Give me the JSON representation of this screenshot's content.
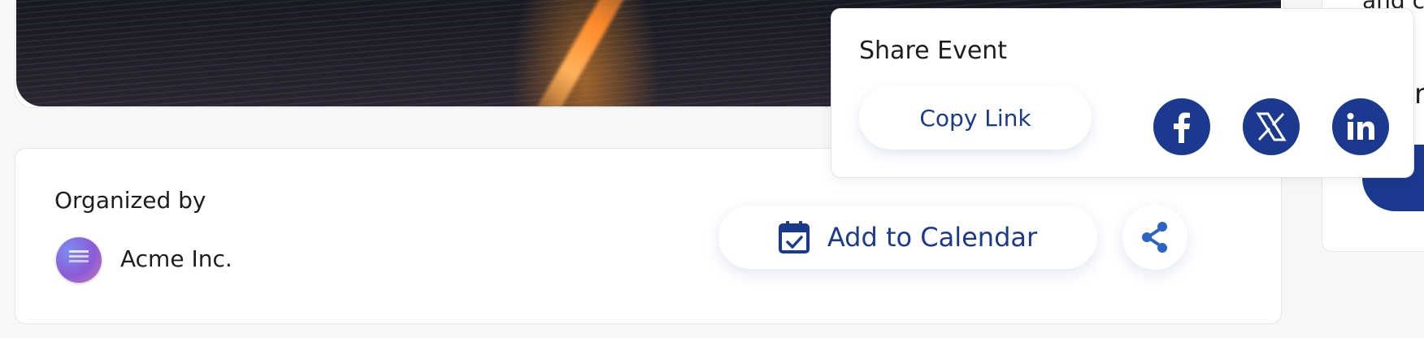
{
  "organizer": {
    "heading": "Organized by",
    "name": "Acme Inc."
  },
  "actions": {
    "add_to_calendar_label": "Add to Calendar"
  },
  "share_popover": {
    "title": "Share Event",
    "copy_link_label": "Copy Link",
    "social": [
      "facebook-icon",
      "x-icon",
      "linkedin-icon"
    ]
  },
  "right_panel": {
    "partial_text": "and ca",
    "partial_letter": "r"
  },
  "icons": {
    "calendar": "calendar-check-icon",
    "share": "share-icon"
  },
  "colors": {
    "accent": "#1b3a8f",
    "share_icon": "#2b63c7",
    "background": "#f7f7f7"
  }
}
